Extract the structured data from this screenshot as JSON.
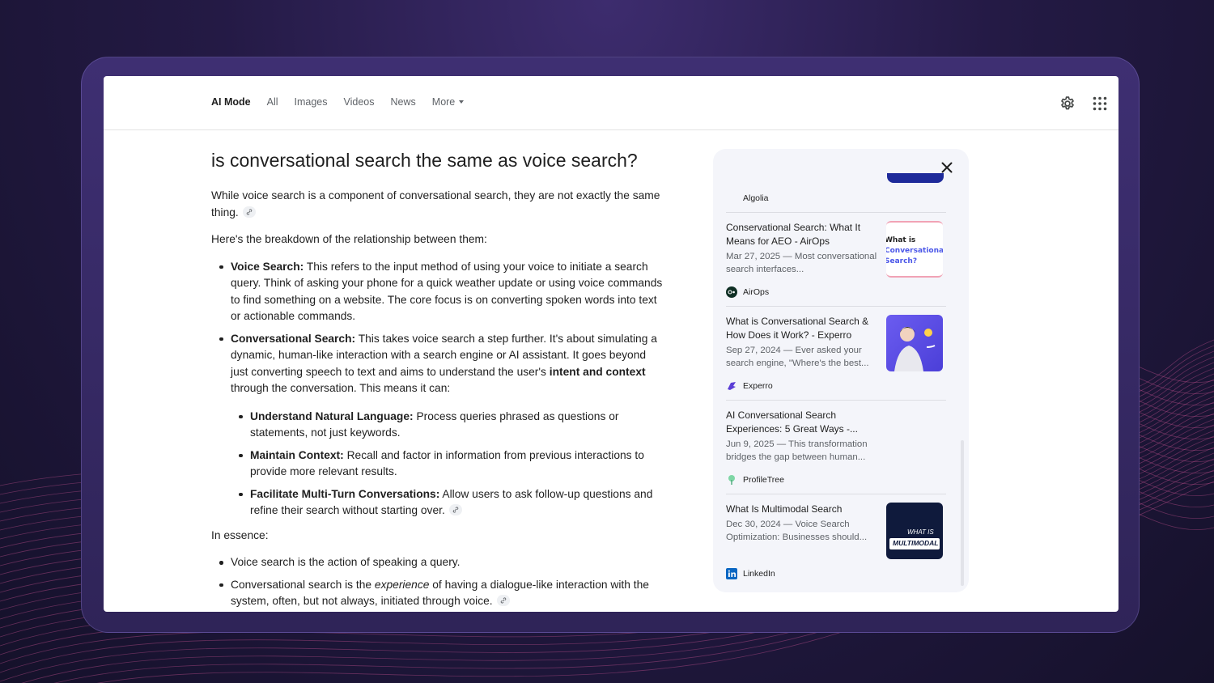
{
  "nav": {
    "tabs": [
      {
        "label": "AI Mode"
      },
      {
        "label": "All"
      },
      {
        "label": "Images"
      },
      {
        "label": "Videos"
      },
      {
        "label": "News"
      },
      {
        "label": "More"
      }
    ],
    "settings_icon": "gear-icon",
    "apps_icon": "grid-apps-icon"
  },
  "answer": {
    "question": "is conversational search the same as voice search?",
    "intro": "While voice search is a component of conversational search, they are not exactly the same thing.",
    "breakdown_lead": "Here's the breakdown of the relationship between them:",
    "voice": {
      "term": "Voice Search:",
      "text": " This refers to the input method of using your voice to initiate a search query. Think of asking your phone for a quick weather update or using voice commands to find something on a website. The core focus is on converting spoken words into text or actionable commands."
    },
    "conversational": {
      "term": "Conversational Search:",
      "text_a": " This takes voice search a step further. It's about simulating a dynamic, human-like interaction with a search engine or AI assistant. It goes beyond just converting speech to text and aims to understand the user's ",
      "bold": "intent and context",
      "text_b": " through the conversation. This means it can:"
    },
    "sub_items": [
      {
        "term": "Understand Natural Language:",
        "text": " Process queries phrased as questions or statements, not just keywords."
      },
      {
        "term": "Maintain Context:",
        "text": " Recall and factor in information from previous interactions to provide more relevant results."
      },
      {
        "term": "Facilitate Multi-Turn Conversations:",
        "text": " Allow users to ask follow-up questions and refine their search without starting over."
      }
    ],
    "essence_lead": "In essence:",
    "essence_1": "Voice search is the action of speaking a query.",
    "essence_2_a": "Conversational search is the ",
    "essence_2_em": "experience",
    "essence_2_b": " of having a dialogue-like interaction with the system, often, but not always, initiated through voice."
  },
  "sources": {
    "top_source": "Algolia",
    "cards": [
      {
        "title": "Conservational Search: What It Means for AEO - AirOps",
        "snippet": "Mar 27, 2025 — Most conversational search interfaces...",
        "source": "AirOps",
        "thumb_text_1": "What is",
        "thumb_text_2": "Conversational",
        "thumb_text_3": "Search?"
      },
      {
        "title": "What is Conversational Search & How Does it Work? - Experro",
        "snippet": "Sep 27, 2024 — Ever asked your search engine, \"Where's the best...",
        "source": "Experro"
      },
      {
        "title": "AI Conversational Search Experiences: 5 Great Ways -...",
        "snippet": "Jun 9, 2025 — This transformation bridges the gap between human...",
        "source": "ProfileTree"
      },
      {
        "title": "What Is Multimodal Search",
        "snippet": "Dec 30, 2024 — Voice Search Optimization: Businesses should...",
        "source": "LinkedIn",
        "thumb_text_1": "WHAT IS",
        "thumb_text_2": "MULTIMODAL SEA"
      }
    ]
  },
  "colors": {
    "accent_purple": "#3d2c6e",
    "linkedin_blue": "#0a66c2",
    "experro_purple": "#5b3fd6"
  }
}
